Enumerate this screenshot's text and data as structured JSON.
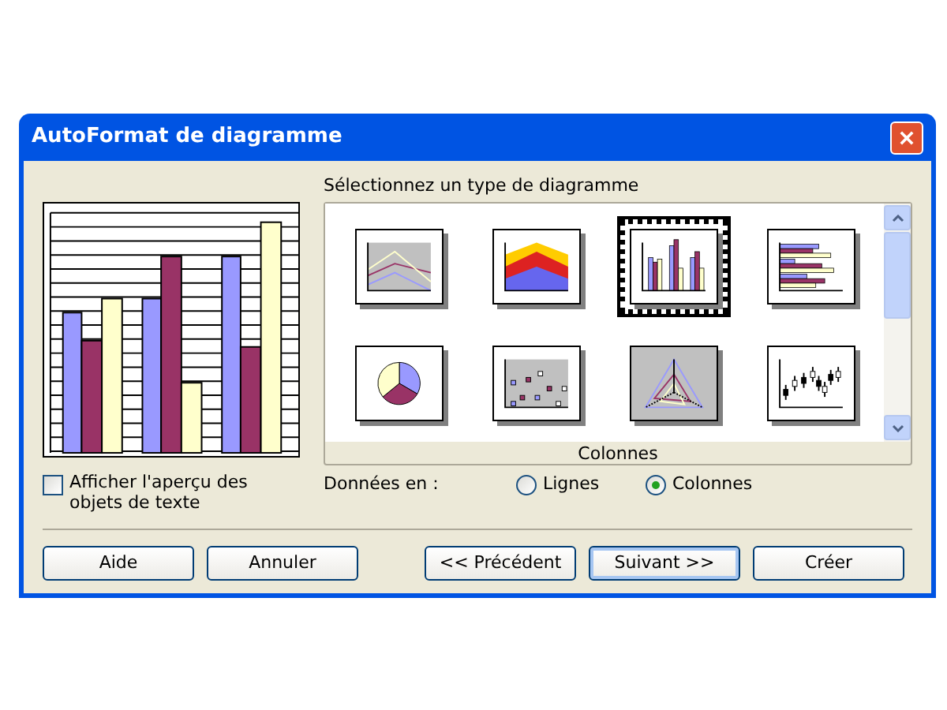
{
  "window": {
    "title": "AutoFormat de diagramme"
  },
  "gallery": {
    "label": "Sélectionnez un type de diagramme",
    "caption": "Colonnes",
    "items": [
      {
        "kind": "line",
        "selected": false
      },
      {
        "kind": "area",
        "selected": false
      },
      {
        "kind": "column",
        "selected": true
      },
      {
        "kind": "bar",
        "selected": false
      },
      {
        "kind": "pie",
        "selected": false
      },
      {
        "kind": "scatter",
        "selected": false
      },
      {
        "kind": "net",
        "selected": false
      },
      {
        "kind": "stock",
        "selected": false
      }
    ]
  },
  "preview_option": {
    "label": "Afficher l'aperçu des objets de texte",
    "checked": false
  },
  "data_series": {
    "label": "Données en :",
    "options": [
      {
        "label": "Lignes",
        "selected": false
      },
      {
        "label": "Colonnes",
        "selected": true
      }
    ]
  },
  "buttons": [
    "Aide",
    "Annuler",
    "<< Précédent",
    "Suivant >>",
    "Créer"
  ]
}
